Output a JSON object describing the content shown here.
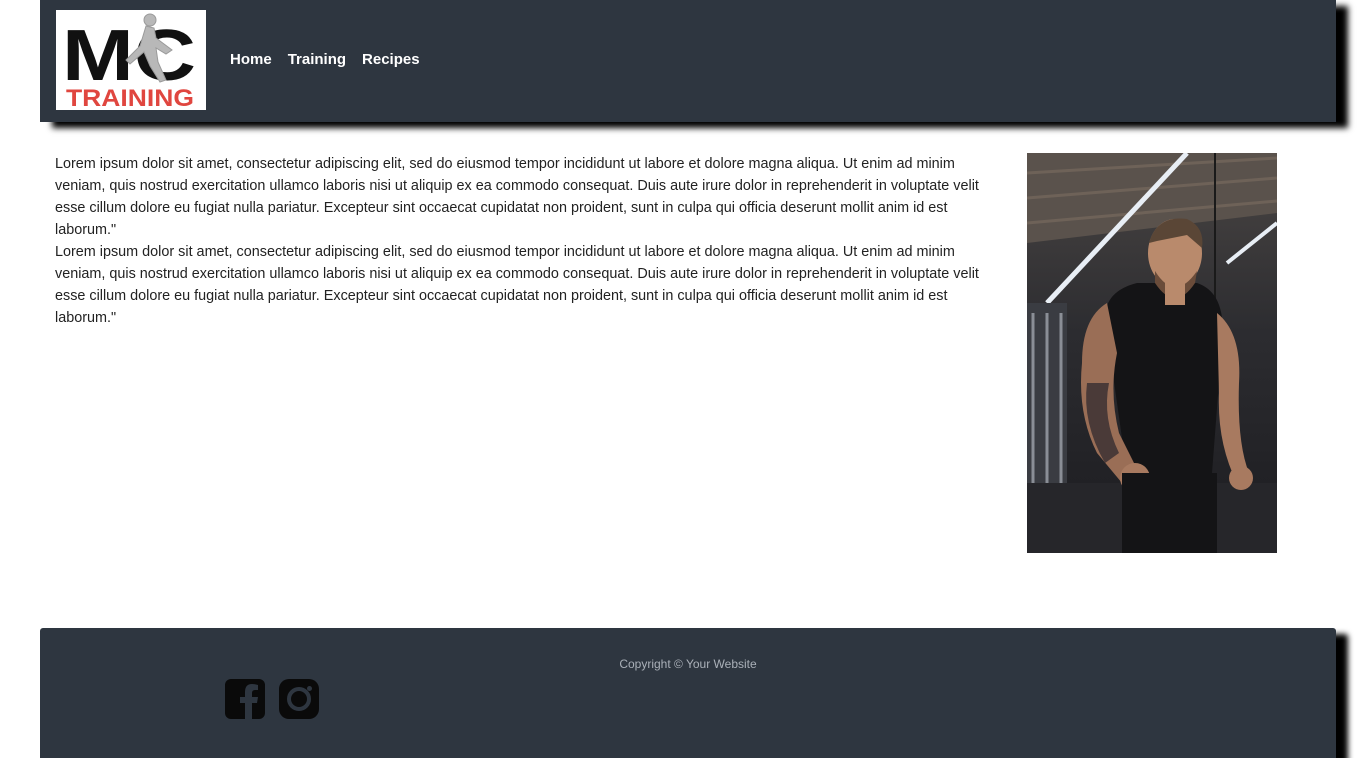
{
  "header": {
    "logo": {
      "text_top": "MC",
      "text_bottom": "TRAINING",
      "icon": "runner-logo-icon",
      "colors": {
        "top": "#111111",
        "bottom": "#e0463f"
      }
    },
    "nav": [
      {
        "label": "Home"
      },
      {
        "label": "Training"
      },
      {
        "label": "Recipes"
      }
    ]
  },
  "main": {
    "paragraphs": [
      "Lorem ipsum dolor sit amet, consectetur adipiscing elit, sed do eiusmod tempor incididunt ut labore et dolore magna aliqua. Ut enim ad minim veniam, quis nostrud exercitation ullamco laboris nisi ut aliquip ex ea commodo consequat. Duis aute irure dolor in reprehenderit in voluptate velit esse cillum dolore eu fugiat nulla pariatur. Excepteur sint occaecat cupidatat non proident, sunt in culpa qui officia deserunt mollit anim id est laborum.\"",
      "Lorem ipsum dolor sit amet, consectetur adipiscing elit, sed do eiusmod tempor incididunt ut labore et dolore magna aliqua. Ut enim ad minim veniam, quis nostrud exercitation ullamco laboris nisi ut aliquip ex ea commodo consequat. Duis aute irure dolor in reprehenderit in voluptate velit esse cillum dolore eu fugiat nulla pariatur. Excepteur sint occaecat cupidatat non proident, sunt in culpa qui officia deserunt mollit anim id est laborum.\""
    ],
    "photo": {
      "icon": "gym-trainer-photo"
    }
  },
  "footer": {
    "copyright": "Copyright © Your Website",
    "social": [
      {
        "icon": "facebook-icon"
      },
      {
        "icon": "instagram-icon"
      }
    ]
  },
  "colors": {
    "bar_background": "#2e3640",
    "nav_text": "#ffffff",
    "body_text": "#222222",
    "copyright_text": "#aab0b8"
  }
}
